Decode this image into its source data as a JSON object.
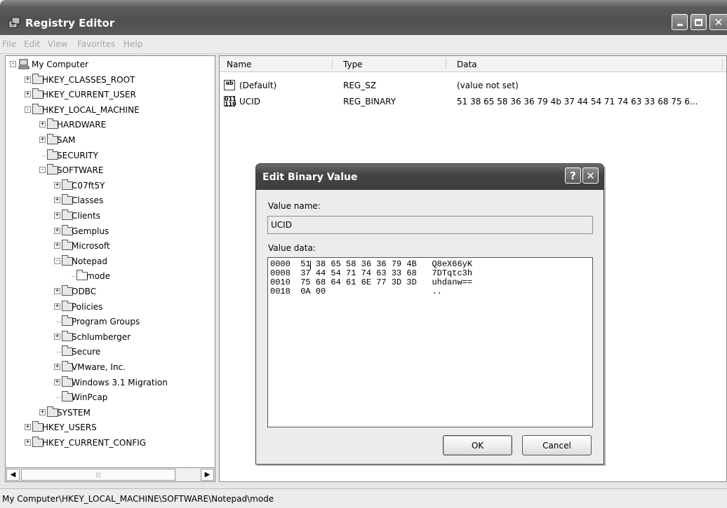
{
  "window": {
    "title": "Registry Editor"
  },
  "menu": [
    "File",
    "Edit",
    "View",
    "Favorites",
    "Help"
  ],
  "tree": [
    {
      "label": "My Computer",
      "depth": 0,
      "expander": "−",
      "icon": "computer"
    },
    {
      "label": "HKEY_CLASSES_ROOT",
      "depth": 1,
      "expander": "+"
    },
    {
      "label": "HKEY_CURRENT_USER",
      "depth": 1,
      "expander": "+"
    },
    {
      "label": "HKEY_LOCAL_MACHINE",
      "depth": 1,
      "expander": "−"
    },
    {
      "label": "HARDWARE",
      "depth": 2,
      "expander": "+"
    },
    {
      "label": "SAM",
      "depth": 2,
      "expander": "+"
    },
    {
      "label": "SECURITY",
      "depth": 2,
      "expander": ""
    },
    {
      "label": "SOFTWARE",
      "depth": 2,
      "expander": "−"
    },
    {
      "label": "C07ft5Y",
      "depth": 3,
      "expander": "+"
    },
    {
      "label": "Classes",
      "depth": 3,
      "expander": "+"
    },
    {
      "label": "Clients",
      "depth": 3,
      "expander": "+"
    },
    {
      "label": "Gemplus",
      "depth": 3,
      "expander": "+"
    },
    {
      "label": "Microsoft",
      "depth": 3,
      "expander": "+"
    },
    {
      "label": "Notepad",
      "depth": 3,
      "expander": "−"
    },
    {
      "label": "mode",
      "depth": 4,
      "expander": "",
      "selected": true
    },
    {
      "label": "ODBC",
      "depth": 3,
      "expander": "+"
    },
    {
      "label": "Policies",
      "depth": 3,
      "expander": "+"
    },
    {
      "label": "Program Groups",
      "depth": 3,
      "expander": ""
    },
    {
      "label": "Schlumberger",
      "depth": 3,
      "expander": "+"
    },
    {
      "label": "Secure",
      "depth": 3,
      "expander": ""
    },
    {
      "label": "VMware, Inc.",
      "depth": 3,
      "expander": "+"
    },
    {
      "label": "Windows 3.1 Migration",
      "depth": 3,
      "expander": "+"
    },
    {
      "label": "WinPcap",
      "depth": 3,
      "expander": ""
    },
    {
      "label": "SYSTEM",
      "depth": 2,
      "expander": "+"
    },
    {
      "label": "HKEY_USERS",
      "depth": 1,
      "expander": "+"
    },
    {
      "label": "HKEY_CURRENT_CONFIG",
      "depth": 1,
      "expander": "+"
    }
  ],
  "list": {
    "columns": [
      "Name",
      "Type",
      "Data"
    ],
    "rows": [
      {
        "icon": "ab",
        "name": "(Default)",
        "type": "REG_SZ",
        "data": "(value not set)"
      },
      {
        "icon": "bin",
        "name": "UCID",
        "type": "REG_BINARY",
        "data": "51 38 65 58 36 36 79 4b 37 44 54 71 74 63 33 68 75 6..."
      }
    ]
  },
  "status": "My Computer\\HKEY_LOCAL_MACHINE\\SOFTWARE\\Notepad\\mode",
  "dialog": {
    "title": "Edit Binary Value",
    "help_glyph": "?",
    "close_glyph": "✕",
    "value_name_label": "Value name:",
    "value_name": "UCID",
    "value_data_label": "Value data:",
    "hex_lines": [
      "0000  51 38 65 58 36 36 79 4B   Q8eX66yK",
      "0008  37 44 54 71 74 63 33 68   7DTqtc3h",
      "0010  75 68 64 61 6E 77 3D 3D   uhdanw==",
      "0018  0A 00                     .."
    ],
    "ok_label": "OK",
    "cancel_label": "Cancel"
  }
}
